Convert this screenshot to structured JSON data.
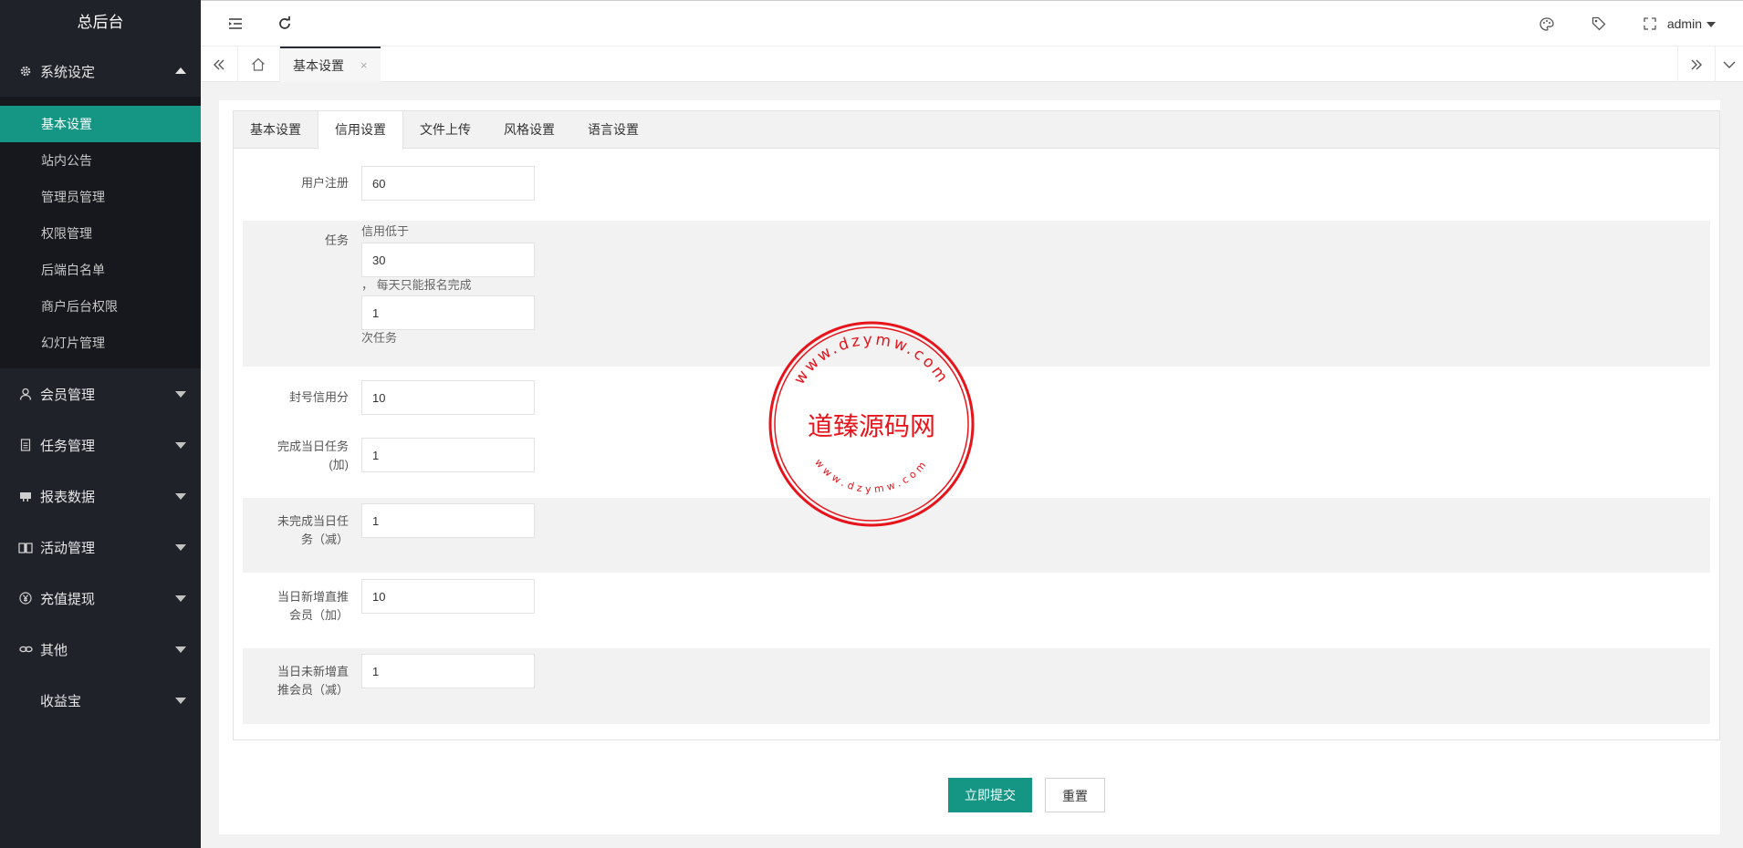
{
  "sidebar": {
    "title": "总后台",
    "groups": [
      {
        "label": "系统设定",
        "icon": "gear-icon"
      },
      {
        "label": "会员管理",
        "icon": "user-icon"
      },
      {
        "label": "任务管理",
        "icon": "document-icon"
      },
      {
        "label": "报表数据",
        "icon": "chart-icon"
      },
      {
        "label": "活动管理",
        "icon": "book-icon"
      },
      {
        "label": "充值提现",
        "icon": "yen-icon"
      },
      {
        "label": "其他",
        "icon": "link-icon"
      },
      {
        "label": "收益宝",
        "icon": ""
      }
    ],
    "sub_items": [
      "基本设置",
      "站内公告",
      "管理员管理",
      "权限管理",
      "后端白名单",
      "商户后台权限",
      "幻灯片管理"
    ]
  },
  "header": {
    "user": "admin",
    "icons": [
      "menu-fold-icon",
      "refresh-icon",
      "palette-icon",
      "tag-icon",
      "fullscreen-icon"
    ]
  },
  "tabbar": {
    "current_tab": "基本设置",
    "close": "×"
  },
  "settings": {
    "tabs": [
      "基本设置",
      "信用设置",
      "文件上传",
      "风格设置",
      "语言设置"
    ],
    "active_tab": "信用设置",
    "fields": {
      "register": {
        "label": "用户注册",
        "value": "60"
      },
      "task": {
        "label": "任务",
        "prefix": "信用低于",
        "value1": "30",
        "middle": "，  每天只能报名完成",
        "value2": "1",
        "suffix": "次任务"
      },
      "ban": {
        "label": "封号信用分",
        "value": "10"
      },
      "complete_plus": {
        "label_1": "完成当日任务",
        "label_2": "(加)",
        "value": "1"
      },
      "incomplete_minus": {
        "label_1": "未完成当日任",
        "label_2": "务（减）",
        "value": "1"
      },
      "new_referral_plus": {
        "label_1": "当日新增直推",
        "label_2": "会员（加）",
        "value": "10"
      },
      "no_referral_minus": {
        "label_1": "当日未新增直",
        "label_2": "推会员（减）",
        "value": "1"
      }
    }
  },
  "actions": {
    "submit": "立即提交",
    "reset": "重置"
  },
  "watermark": {
    "name": "道臻源码网",
    "url_top": "www.dzymw.com",
    "url_bottom": "www.dzymw.com",
    "color": "#e8141b"
  },
  "colors": {
    "accent": "#159583",
    "sidebar": "#20222a"
  }
}
